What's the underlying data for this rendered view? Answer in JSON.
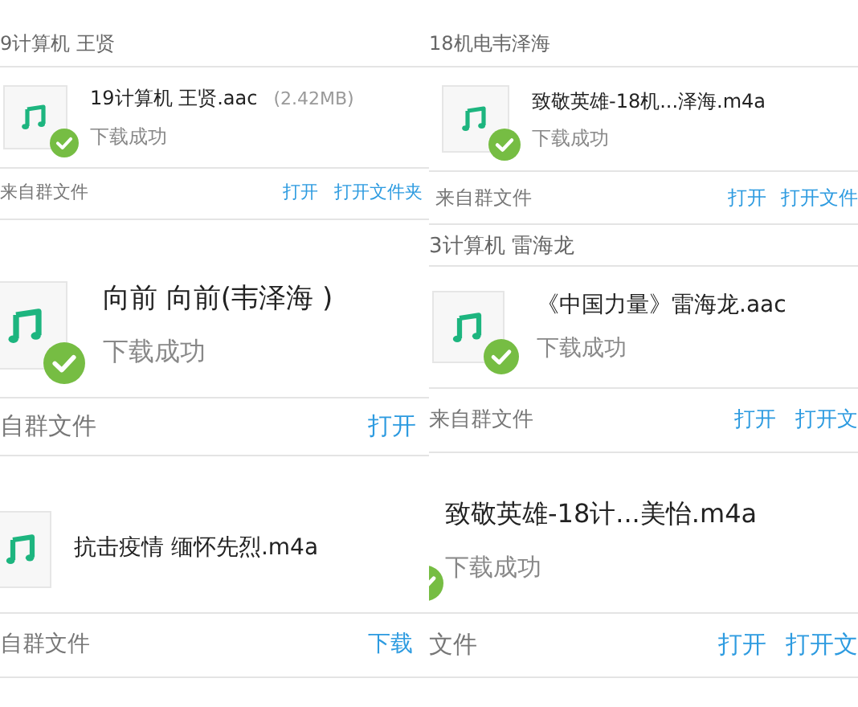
{
  "columns": [
    {
      "tiles": [
        {
          "sender": "9计算机 王贤",
          "file": {
            "name": "19计算机 王贤.aac",
            "size": "(2.42MB)",
            "status": "下载成功",
            "downloaded": true
          },
          "footer": {
            "source": "来自群文件",
            "actions": [
              "打开",
              "打开文件夹"
            ]
          }
        },
        {
          "file": {
            "name": "向前 向前(韦泽海 )",
            "status": "下载成功",
            "downloaded": true
          },
          "footer": {
            "source": "自群文件",
            "actions": [
              "打开"
            ]
          }
        },
        {
          "file": {
            "name": "抗击疫情 缅怀先烈.m4a",
            "downloaded": false
          },
          "footer": {
            "source": "自群文件",
            "actions": [
              "下载"
            ]
          }
        }
      ]
    },
    {
      "tiles": [
        {
          "sender": "18机电韦泽海",
          "file": {
            "name": "致敬英雄-18机...泽海.m4a",
            "status": "下载成功",
            "downloaded": true
          },
          "footer": {
            "source": "来自群文件",
            "actions": [
              "打开",
              "打开文件"
            ]
          }
        },
        {
          "sender": "3计算机 雷海龙",
          "file": {
            "name": "《中国力量》雷海龙.aac",
            "status": "下载成功",
            "downloaded": true
          },
          "footer": {
            "source": "来自群文件",
            "actions": [
              "打开",
              "打开文"
            ]
          }
        },
        {
          "file": {
            "name": "致敬英雄-18计...美怡.m4a",
            "status": "下载成功",
            "downloaded": true
          },
          "footer": {
            "source": "文件",
            "actions": [
              "打开",
              "打开文"
            ]
          }
        }
      ]
    }
  ]
}
